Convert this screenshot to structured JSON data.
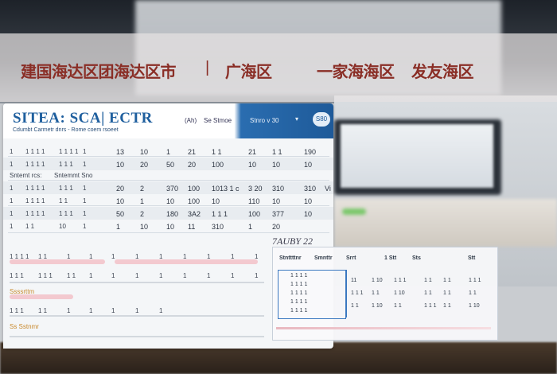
{
  "banner": {
    "segments": [
      "建国海达区团海达区市",
      "|",
      "广海区",
      "一家海海区",
      "发友海区"
    ]
  },
  "window": {
    "title": "SITEA: SCA| ECTR",
    "subtitle": "Cdumbt Carmetr dnrs - Rome coem rsoeet",
    "tabs": [
      "(Ah)",
      "Se Stmoe",
      "Stnro v  30"
    ],
    "chevron": "▾",
    "round_button": "S80",
    "rows": [
      {
        "cells": [
          "1",
          "1  1  1  1",
          "1  1  1  1",
          "1",
          "13",
          "10",
          "1",
          "21",
          "1  1",
          "21",
          "1 1",
          "190"
        ]
      },
      {
        "cells": [
          "1",
          "1  1  1  1",
          "1  1  1",
          "1",
          "10",
          "20",
          "50",
          "20",
          "100",
          "10",
          "10",
          "10"
        ]
      },
      {
        "cells": [
          "Sntemt rcs:",
          "Sntemmt Sno"
        ]
      },
      {
        "cells": [
          "1",
          "1  1  1  1",
          "1  1  1",
          "1",
          "20",
          "2",
          "370",
          "100",
          "1013 1 c",
          "3 20",
          "310",
          "310",
          "Vi"
        ]
      },
      {
        "cells": [
          "1",
          "1  1  1  1",
          "1  1",
          "1",
          "10",
          "1",
          "10",
          "100",
          "10",
          "110",
          "10",
          "10"
        ]
      },
      {
        "cells": [
          "1",
          "1  1  1  1",
          "1  1  1",
          "1",
          "50",
          "2",
          "180",
          "3A2",
          "1  1  1",
          "100",
          "377",
          "10"
        ]
      },
      {
        "cells": [
          "1",
          "1  1",
          "10",
          "1",
          "1",
          "10",
          "10",
          "11",
          "310",
          "1",
          "20"
        ]
      }
    ],
    "lower_rows": [
      {
        "cells": [
          "1  1  1  1",
          "1  1",
          "1",
          "1",
          "1",
          "1",
          "1",
          "1",
          "1",
          "1",
          "1"
        ]
      },
      {
        "cells": [
          "1  1  1",
          "1  1  1",
          "1  1",
          "1",
          "1",
          "1",
          "1",
          "1",
          "1",
          "1",
          "1"
        ]
      },
      {
        "cells": [
          "Ssssrttm"
        ]
      },
      {
        "cells": [
          "1  1  1",
          "1  1",
          "1",
          "1",
          "1",
          "1",
          "1"
        ]
      },
      {
        "cells": [
          "Ss  Sstnmr"
        ]
      }
    ],
    "stamp": "7AUBY 22"
  },
  "panel": {
    "header": [
      "Stnttttnr",
      "Smnttr",
      "Srrt",
      "1 Stt",
      "Sts",
      "Stt"
    ],
    "left_col": [
      "1  1  1  1",
      "1  1  1  1",
      "1  1  1  1",
      "1  1  1  1",
      "1  1  1  1"
    ],
    "grid": [
      [
        "11",
        "1  10",
        "1  1  1",
        "1  1",
        "1  1",
        "1  1  1"
      ],
      [
        "1  1  1",
        "1  1",
        "1  10",
        "1  1",
        "1  1",
        "1  1"
      ],
      [
        "1  1",
        "1  10",
        "1  1",
        "1  1  1",
        "1  1",
        "1  10"
      ]
    ]
  },
  "colors": {
    "accent": "#1e5a99",
    "banner_text": "#8a2e26",
    "pink": "#f3c9cf"
  }
}
